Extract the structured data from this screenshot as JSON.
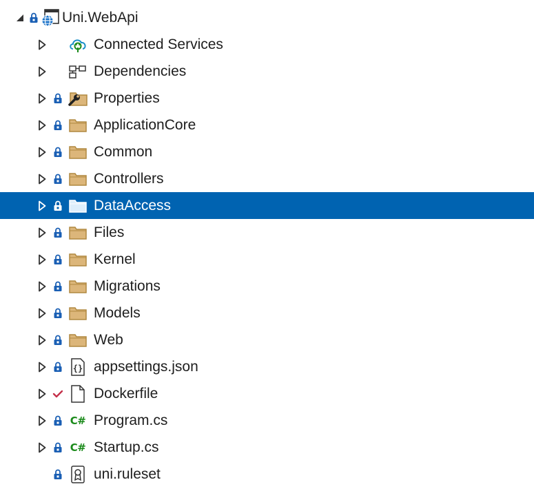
{
  "accent_color": "#0063b1",
  "folder_color": "#dcb67a",
  "lock_color": "#1a5fb4",
  "csharp_color": "#1a8a1a",
  "items": [
    {
      "label": "Uni.WebApi",
      "icon": "web-project-icon",
      "expander": "expanded",
      "lock": true
    },
    {
      "label": "Connected Services",
      "icon": "connected-services-icon",
      "expander": "collapsed",
      "lock": false
    },
    {
      "label": "Dependencies",
      "icon": "dependencies-icon",
      "expander": "collapsed",
      "lock": false
    },
    {
      "label": "Properties",
      "icon": "properties-folder-icon",
      "expander": "collapsed",
      "lock": true
    },
    {
      "label": "ApplicationCore",
      "icon": "folder-icon",
      "expander": "collapsed",
      "lock": true
    },
    {
      "label": "Common",
      "icon": "folder-icon",
      "expander": "collapsed",
      "lock": true
    },
    {
      "label": "Controllers",
      "icon": "folder-icon",
      "expander": "collapsed",
      "lock": true
    },
    {
      "label": "DataAccess",
      "icon": "folder-icon",
      "expander": "collapsed",
      "lock": true,
      "selected": true
    },
    {
      "label": "Files",
      "icon": "folder-icon",
      "expander": "collapsed",
      "lock": true
    },
    {
      "label": "Kernel",
      "icon": "folder-icon",
      "expander": "collapsed",
      "lock": true
    },
    {
      "label": "Migrations",
      "icon": "folder-icon",
      "expander": "collapsed",
      "lock": true
    },
    {
      "label": "Models",
      "icon": "folder-icon",
      "expander": "collapsed",
      "lock": true
    },
    {
      "label": "Web",
      "icon": "folder-icon",
      "expander": "collapsed",
      "lock": true
    },
    {
      "label": "appsettings.json",
      "icon": "json-file-icon",
      "expander": "collapsed",
      "lock": true
    },
    {
      "label": "Dockerfile",
      "icon": "file-icon",
      "expander": "collapsed",
      "lock": false,
      "pending_change": true
    },
    {
      "label": "Program.cs",
      "icon": "csharp-file-icon",
      "icon_text": "C#",
      "expander": "collapsed",
      "lock": true
    },
    {
      "label": "Startup.cs",
      "icon": "csharp-file-icon",
      "icon_text": "C#",
      "expander": "collapsed",
      "lock": true
    },
    {
      "label": "uni.ruleset",
      "icon": "ruleset-file-icon",
      "expander": "none",
      "lock": true
    }
  ]
}
